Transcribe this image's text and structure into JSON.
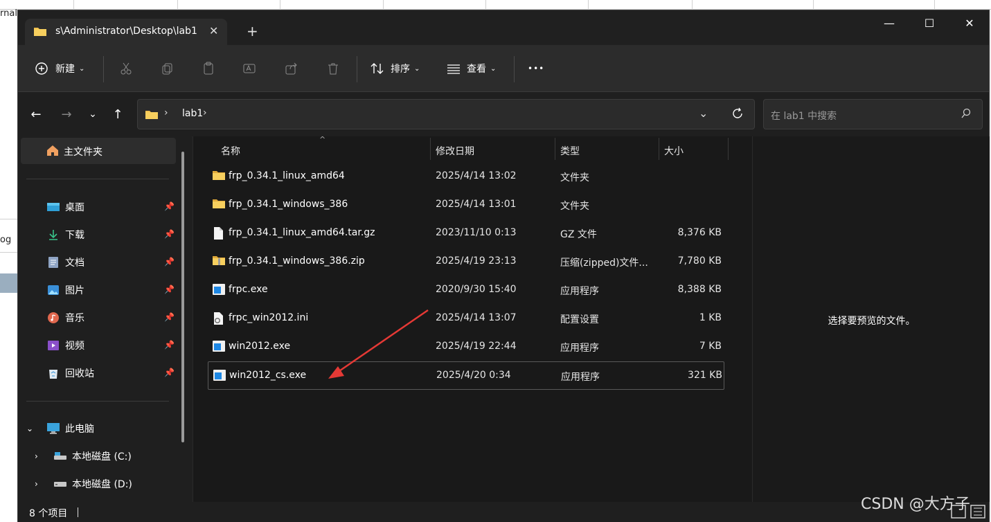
{
  "background": {
    "left_cells": [
      "rnal",
      "og"
    ],
    "selection_color": "#9aaebf"
  },
  "tab": {
    "title": "s\\Administrator\\Desktop\\lab1",
    "close_icon": "close-icon",
    "new_tab_icon": "plus-icon"
  },
  "window_controls": {
    "minimize": "—",
    "maximize": "☐",
    "close": "✕"
  },
  "toolbar": {
    "new_label": "新建",
    "sort_label": "排序",
    "view_label": "查看",
    "more_label": "•••"
  },
  "address": {
    "crumb": "lab1",
    "search_placeholder": "在 lab1 中搜索"
  },
  "nav": {
    "home": "主文件夹",
    "quick": [
      {
        "label": "桌面",
        "icon": "desktop-icon"
      },
      {
        "label": "下载",
        "icon": "download-icon"
      },
      {
        "label": "文档",
        "icon": "documents-icon"
      },
      {
        "label": "图片",
        "icon": "pictures-icon"
      },
      {
        "label": "音乐",
        "icon": "music-icon"
      },
      {
        "label": "视频",
        "icon": "videos-icon"
      },
      {
        "label": "回收站",
        "icon": "recycle-bin-icon"
      }
    ],
    "this_pc": "此电脑",
    "drives": [
      "本地磁盘 (C:)",
      "本地磁盘 (D:)"
    ]
  },
  "columns": {
    "name": "名称",
    "date": "修改日期",
    "type": "类型",
    "size": "大小"
  },
  "files": [
    {
      "name": "frp_0.34.1_linux_amd64",
      "date": "2025/4/14 13:02",
      "type": "文件夹",
      "size": "",
      "icon": "folder-icon"
    },
    {
      "name": "frp_0.34.1_windows_386",
      "date": "2025/4/14 13:01",
      "type": "文件夹",
      "size": "",
      "icon": "folder-icon"
    },
    {
      "name": "frp_0.34.1_linux_amd64.tar.gz",
      "date": "2023/11/10 0:13",
      "type": "GZ 文件",
      "size": "8,376 KB",
      "icon": "file-icon"
    },
    {
      "name": "frp_0.34.1_windows_386.zip",
      "date": "2025/4/19 23:13",
      "type": "压缩(zipped)文件...",
      "size": "7,780 KB",
      "icon": "zip-folder-icon"
    },
    {
      "name": "frpc.exe",
      "date": "2020/9/30 15:40",
      "type": "应用程序",
      "size": "8,388 KB",
      "icon": "exe-icon"
    },
    {
      "name": "frpc_win2012.ini",
      "date": "2025/4/14 13:07",
      "type": "配置设置",
      "size": "1 KB",
      "icon": "ini-icon"
    },
    {
      "name": "win2012.exe",
      "date": "2025/4/19 22:44",
      "type": "应用程序",
      "size": "7 KB",
      "icon": "exe-icon"
    },
    {
      "name": "win2012_cs.exe",
      "date": "2025/4/20 0:34",
      "type": "应用程序",
      "size": "321 KB",
      "icon": "exe-icon"
    }
  ],
  "preview": {
    "message": "选择要预览的文件。"
  },
  "status": {
    "count": "8 个项目"
  },
  "watermark": "CSDN @大方子",
  "colors": {
    "window_bg": "#202020",
    "toolbar_bg": "#2c2c2c",
    "folder": "#f2c14e",
    "arrow": "#e53935"
  }
}
